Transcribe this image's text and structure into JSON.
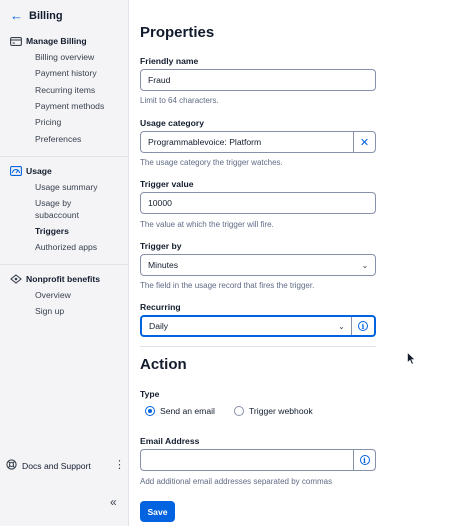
{
  "sidebar": {
    "back_label": "Billing",
    "groups": [
      {
        "title": "Manage Billing",
        "icon": "billing-card-icon",
        "items": [
          "Billing overview",
          "Payment history",
          "Recurring items",
          "Payment methods",
          "Pricing",
          "Preferences"
        ]
      },
      {
        "title": "Usage",
        "icon": "usage-gauge-icon",
        "items": [
          "Usage summary",
          "Usage by",
          "subaccount",
          "Triggers",
          "Authorized apps"
        ]
      },
      {
        "title": "Nonprofit benefits",
        "icon": "nonprofit-icon",
        "items": [
          "Overview",
          "Sign up"
        ]
      }
    ],
    "active_item": "Triggers",
    "docs_label": "Docs and Support"
  },
  "properties": {
    "heading": "Properties",
    "friendly_name": {
      "label": "Friendly name",
      "value": "Fraud",
      "help": "Limit to 64 characters."
    },
    "usage_category": {
      "label": "Usage category",
      "value": "Programmablevoice: Platform",
      "help": "The usage category the trigger watches."
    },
    "trigger_value": {
      "label": "Trigger value",
      "value": "10000",
      "help": "The value at which the trigger will fire."
    },
    "trigger_by": {
      "label": "Trigger by",
      "value": "Minutes",
      "help": "The field in the usage record that fires the trigger."
    },
    "recurring": {
      "label": "Recurring",
      "value": "Daily"
    }
  },
  "action": {
    "heading": "Action",
    "type_label": "Type",
    "options": [
      "Send an email",
      "Trigger webhook"
    ],
    "selected": "Send an email",
    "email": {
      "label": "Email Address",
      "value": "",
      "help": "Add additional email addresses separated by commas"
    },
    "save_label": "Save"
  },
  "colors": {
    "accent": "#0263e0",
    "text": "#121c2d",
    "muted": "#606b85",
    "sidebar_bg": "#f4f4f6"
  }
}
